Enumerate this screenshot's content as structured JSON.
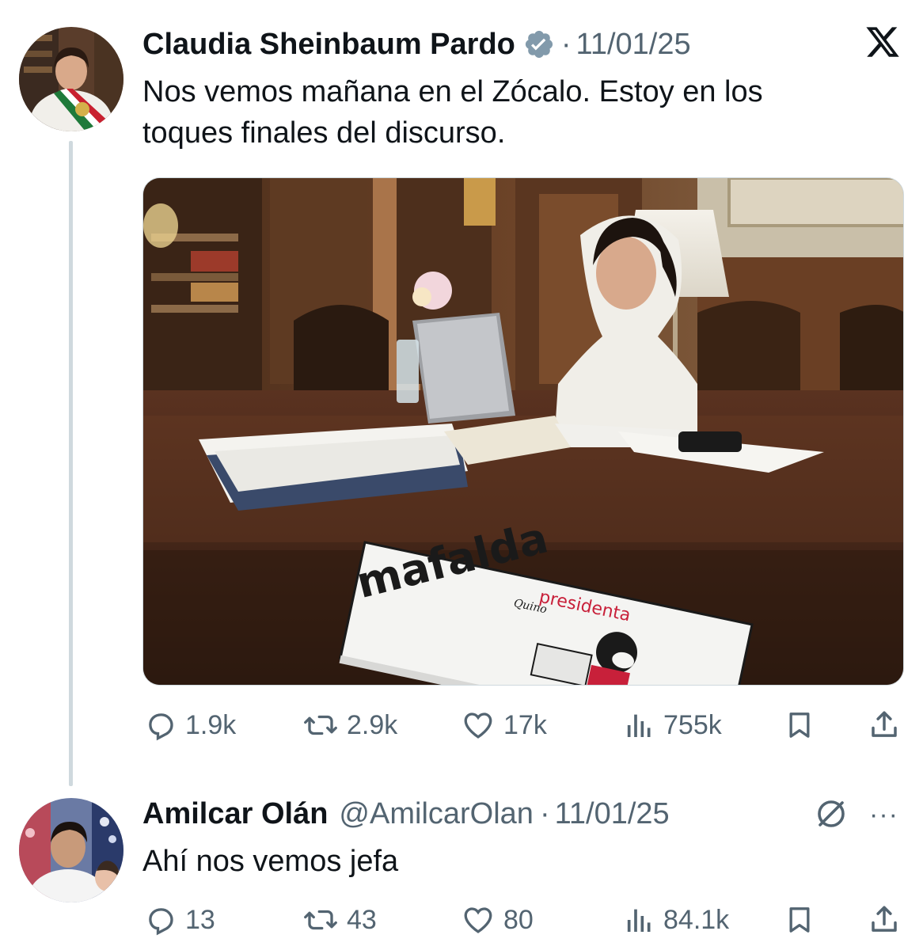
{
  "tweet1": {
    "author_name": "Claudia Sheinbaum Pardo",
    "separator": "·",
    "date": "11/01/25",
    "text_line1": "Nos vemos mañana en el Zócalo. Estoy en los",
    "text_line2": "toques finales del discurso.",
    "replies": "1.9k",
    "reposts": "2.9k",
    "likes": "17k",
    "views": "755k",
    "image_book_title": "mafalda",
    "image_book_subtitle": "presidenta",
    "image_book_brand": "Quino"
  },
  "tweet2": {
    "author_name": "Amilcar Olán",
    "handle": "@AmilcarOlan",
    "separator": "·",
    "date": "11/01/25",
    "text": "Ahí nos vemos jefa",
    "replies": "13",
    "reposts": "43",
    "likes": "80",
    "views": "84.1k",
    "more": "···"
  },
  "icons": {
    "verified": "verified-badge-icon",
    "x_logo": "x-logo-icon",
    "reply": "reply-icon",
    "repost": "repost-icon",
    "like": "heart-icon",
    "views": "views-icon",
    "bookmark": "bookmark-icon",
    "share": "share-icon",
    "grok": "grok-icon",
    "more": "more-icon"
  },
  "colors": {
    "text": "#0f1419",
    "secondary": "#536471",
    "thread_line": "#cfd9de"
  }
}
